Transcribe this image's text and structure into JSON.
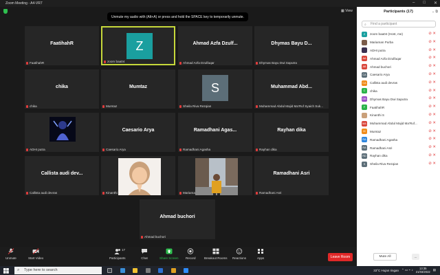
{
  "window": {
    "title": "Zoom Meeting - A4-VR7",
    "view_label": "View"
  },
  "notice": "Unmute my audio with (Alt+A) or press and hold the SPACE key to temporarily unmute.",
  "tiles": [
    {
      "big": "FaatihahR",
      "tag": "FaatihahR"
    },
    {
      "big": "",
      "tag": "zoom baa04",
      "avatar_letter": "Z",
      "avatar_color": "#1a9f9f"
    },
    {
      "big": "Ahmad Azfa Dzulf...",
      "tag": "Ahmad Azfa Dzulfaqar"
    },
    {
      "big": "Dhymas Bayu D...",
      "tag": "Dhymas Bayu Dwi Saputra"
    },
    {
      "big": "chika",
      "tag": "chika"
    },
    {
      "big": "Mumtaz",
      "tag": "Mumtaz"
    },
    {
      "big": "",
      "tag": "Sheila Riva Rezqian",
      "avatar_letter": "S",
      "avatar_color": "#5c6e78"
    },
    {
      "big": "Muhammad Abd...",
      "tag": "Muhammad Abdul Majid Ma'Ruf Syaich Suk..."
    },
    {
      "big": "",
      "tag": "ADHI putra"
    },
    {
      "big": "Caesario Arya",
      "tag": "Caesario Arya"
    },
    {
      "big": "Ramadhani Agas...",
      "tag": "Ramadhani Agasha"
    },
    {
      "big": "Rayhan dika",
      "tag": "Rayhan dika"
    },
    {
      "big": "Callista audi dev...",
      "tag": "Callista audi devras"
    },
    {
      "big": "",
      "tag": "Kinanthi S"
    },
    {
      "big": "",
      "tag": "Mariaman Purba"
    },
    {
      "big": "Ramadhani Asri",
      "tag": "Ramadhani Asri"
    },
    {
      "big": "Ahmad buchori",
      "tag": "Ahmad buchori"
    }
  ],
  "toolbar": {
    "unmute": "Unmute",
    "start_video": "Start Video",
    "participants": "Participants",
    "participants_count": "17",
    "chat": "Chat",
    "share_screen": "Share Screen",
    "record": "Record",
    "breakout_rooms": "Breakout Rooms",
    "reactions": "Reactions",
    "apps": "Apps",
    "leave": "Leave Room"
  },
  "panel": {
    "title": "Participants (17)",
    "search_placeholder": "Find a participant",
    "mute_all": "Mute All",
    "more": "...",
    "participants": [
      {
        "initials": "Z",
        "name": "zoom baa04 (Host, me)",
        "color": "#1a9f9f"
      },
      {
        "initials": "",
        "name": "Mariaman Purba",
        "color": "#7a5c4a"
      },
      {
        "initials": "",
        "name": "ADHI putra",
        "color": "#3a3050"
      },
      {
        "initials": "AA",
        "name": "Ahmad Azfa Dzulfaqar",
        "color": "#d9463b"
      },
      {
        "initials": "AB",
        "name": "Ahmad buchori",
        "color": "#d9463b"
      },
      {
        "initials": "CA",
        "name": "Caesario Arya",
        "color": "#5c6e78"
      },
      {
        "initials": "CA",
        "name": "Callista audi devras",
        "color": "#f08c1a"
      },
      {
        "initials": "C",
        "name": "chika",
        "color": "#2ab34a"
      },
      {
        "initials": "DB",
        "name": "Dhymas Bayu Dwi Saputra",
        "color": "#9b4fc7"
      },
      {
        "initials": "F",
        "name": "FaatihahR",
        "color": "#2ab34a"
      },
      {
        "initials": "",
        "name": "Kinanthi S",
        "color": "#c9a07a"
      },
      {
        "initials": "MA",
        "name": "Muhammad Abdul Majid Ma'Ruf...",
        "color": "#d9463b"
      },
      {
        "initials": "M",
        "name": "Mumtaz",
        "color": "#f08c1a"
      },
      {
        "initials": "RA",
        "name": "Ramadhani Agasha",
        "color": "#2e86de"
      },
      {
        "initials": "RA",
        "name": "Ramadhani Asri",
        "color": "#5c6e78"
      },
      {
        "initials": "RD",
        "name": "Rayhan dika",
        "color": "#5c6e78"
      },
      {
        "initials": "S",
        "name": "Sheila Riva Rezqian",
        "color": "#5c6e78"
      }
    ]
  },
  "taskbar": {
    "search_placeholder": "Type here to search",
    "weather": "33°C  Hujan ringan",
    "time": "13:35",
    "date": "21/03/2022"
  }
}
